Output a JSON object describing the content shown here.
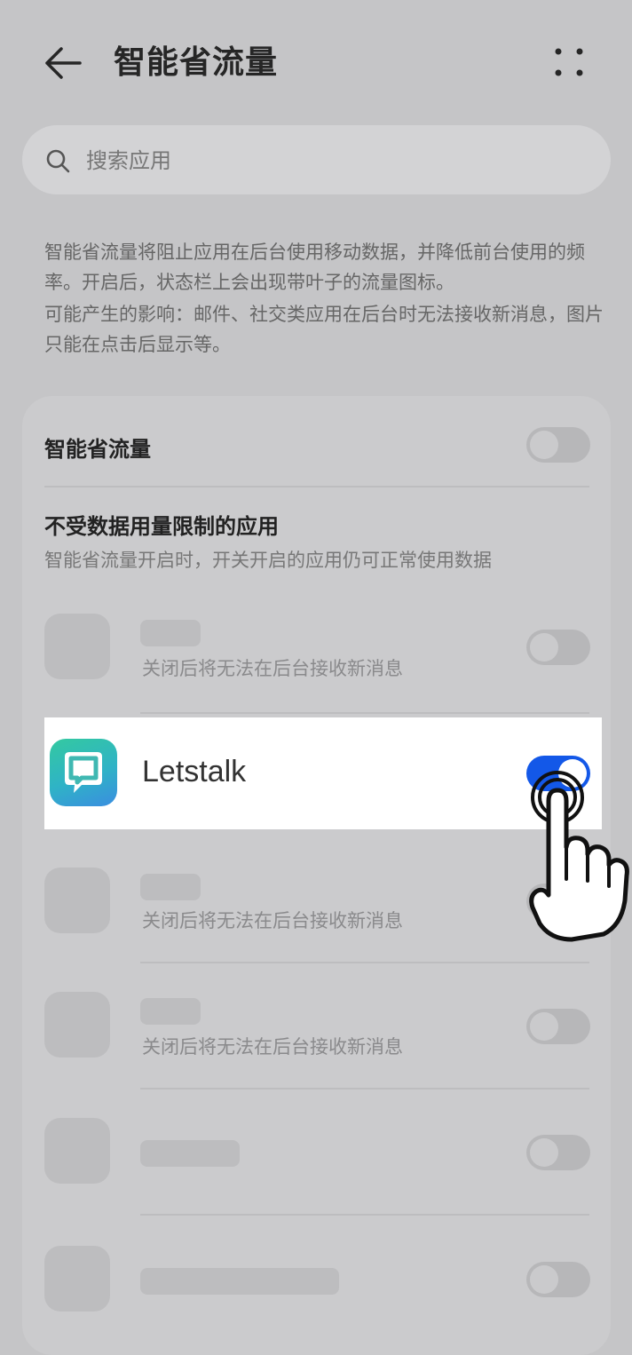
{
  "header": {
    "title": "智能省流量",
    "back_icon": "arrow-left-icon",
    "more_icon": "more-dots-icon"
  },
  "search": {
    "placeholder": "搜索应用",
    "icon": "search-icon"
  },
  "description": {
    "line1": "智能省流量将阻止应用在后台使用移动数据，并降低前台使用的频率。开启后，状态栏上会出现带叶子的流量图标。",
    "line2": "可能产生的影响：邮件、社交类应用在后台时无法接收新消息，图片只能在点击后显示等。"
  },
  "settings": {
    "smart_saver": {
      "label": "智能省流量",
      "on": false
    },
    "unrestricted": {
      "title": "不受数据用量限制的应用",
      "subtitle": "智能省流量开启时，开关开启的应用仍可正常使用数据"
    }
  },
  "apps": [
    {
      "name": "",
      "subtitle": "关闭后将无法在后台接收新消息",
      "on": false
    },
    {
      "name": "Letstalk",
      "subtitle": "",
      "on": true,
      "highlighted": true
    },
    {
      "name": "",
      "subtitle": "关闭后将无法在后台接收新消息",
      "on": false
    },
    {
      "name": "",
      "subtitle": "关闭后将无法在后台接收新消息",
      "on": false
    },
    {
      "name": "",
      "subtitle": "",
      "on": false
    },
    {
      "name": "",
      "subtitle": "",
      "on": false
    }
  ],
  "colors": {
    "accent": "#1358e8",
    "background": "#c5c5c7",
    "highlight": "#ffffff"
  },
  "overlay": {
    "icon": "tap-hand-icon"
  }
}
